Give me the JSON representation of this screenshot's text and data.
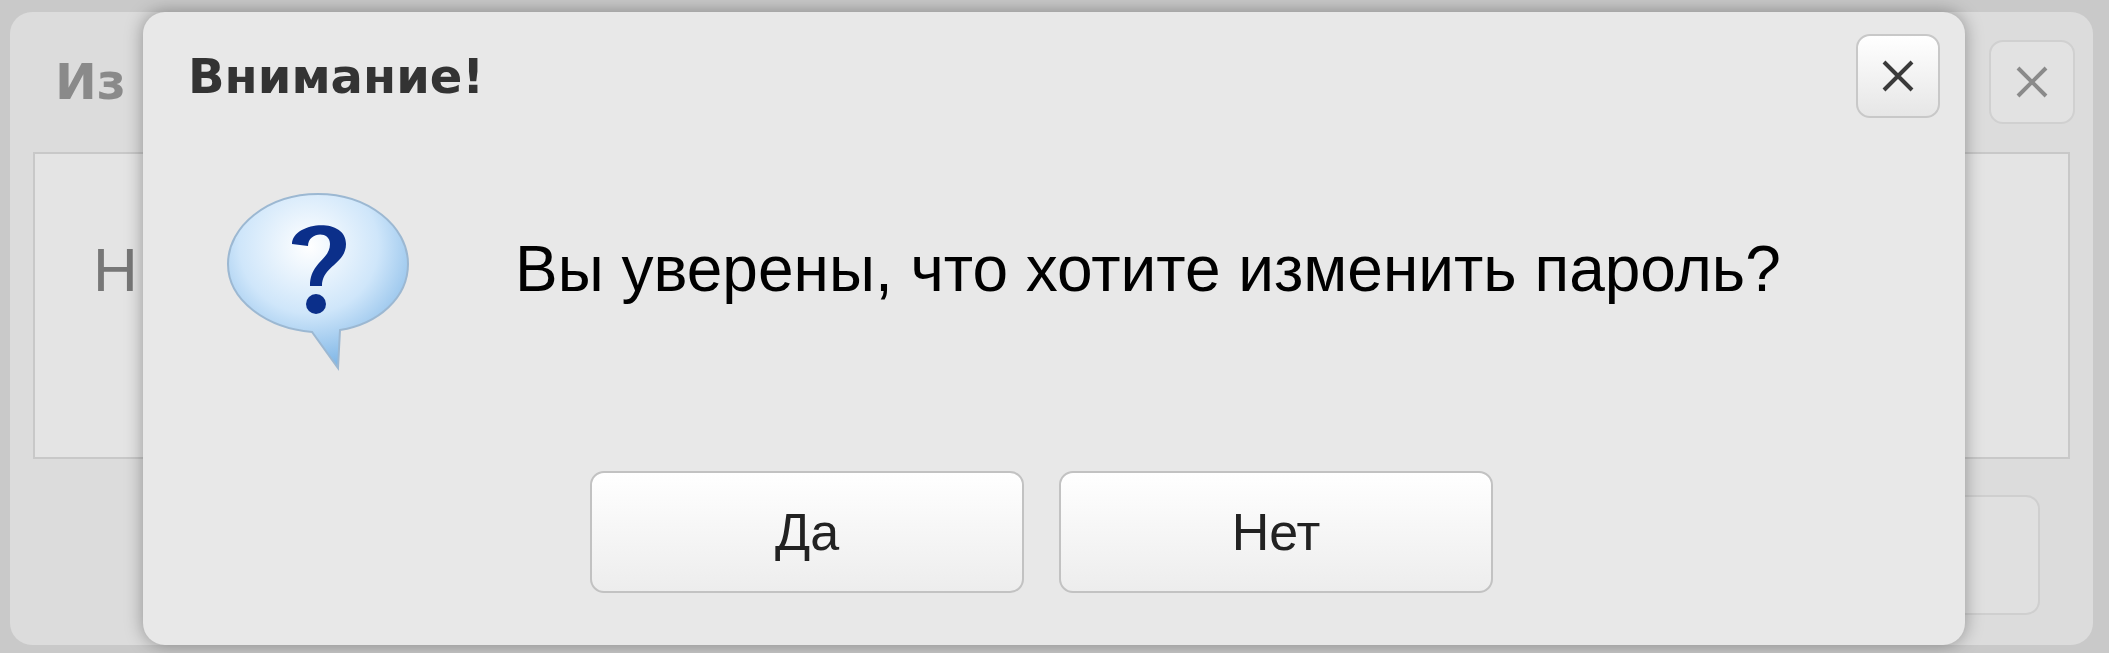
{
  "background_window": {
    "title": "Из",
    "text": "Н"
  },
  "dialog": {
    "title": "Внимание!",
    "message": "Вы уверены, что хотите изменить пароль?",
    "buttons": [
      {
        "label": "Да"
      },
      {
        "label": "Нет"
      }
    ]
  }
}
